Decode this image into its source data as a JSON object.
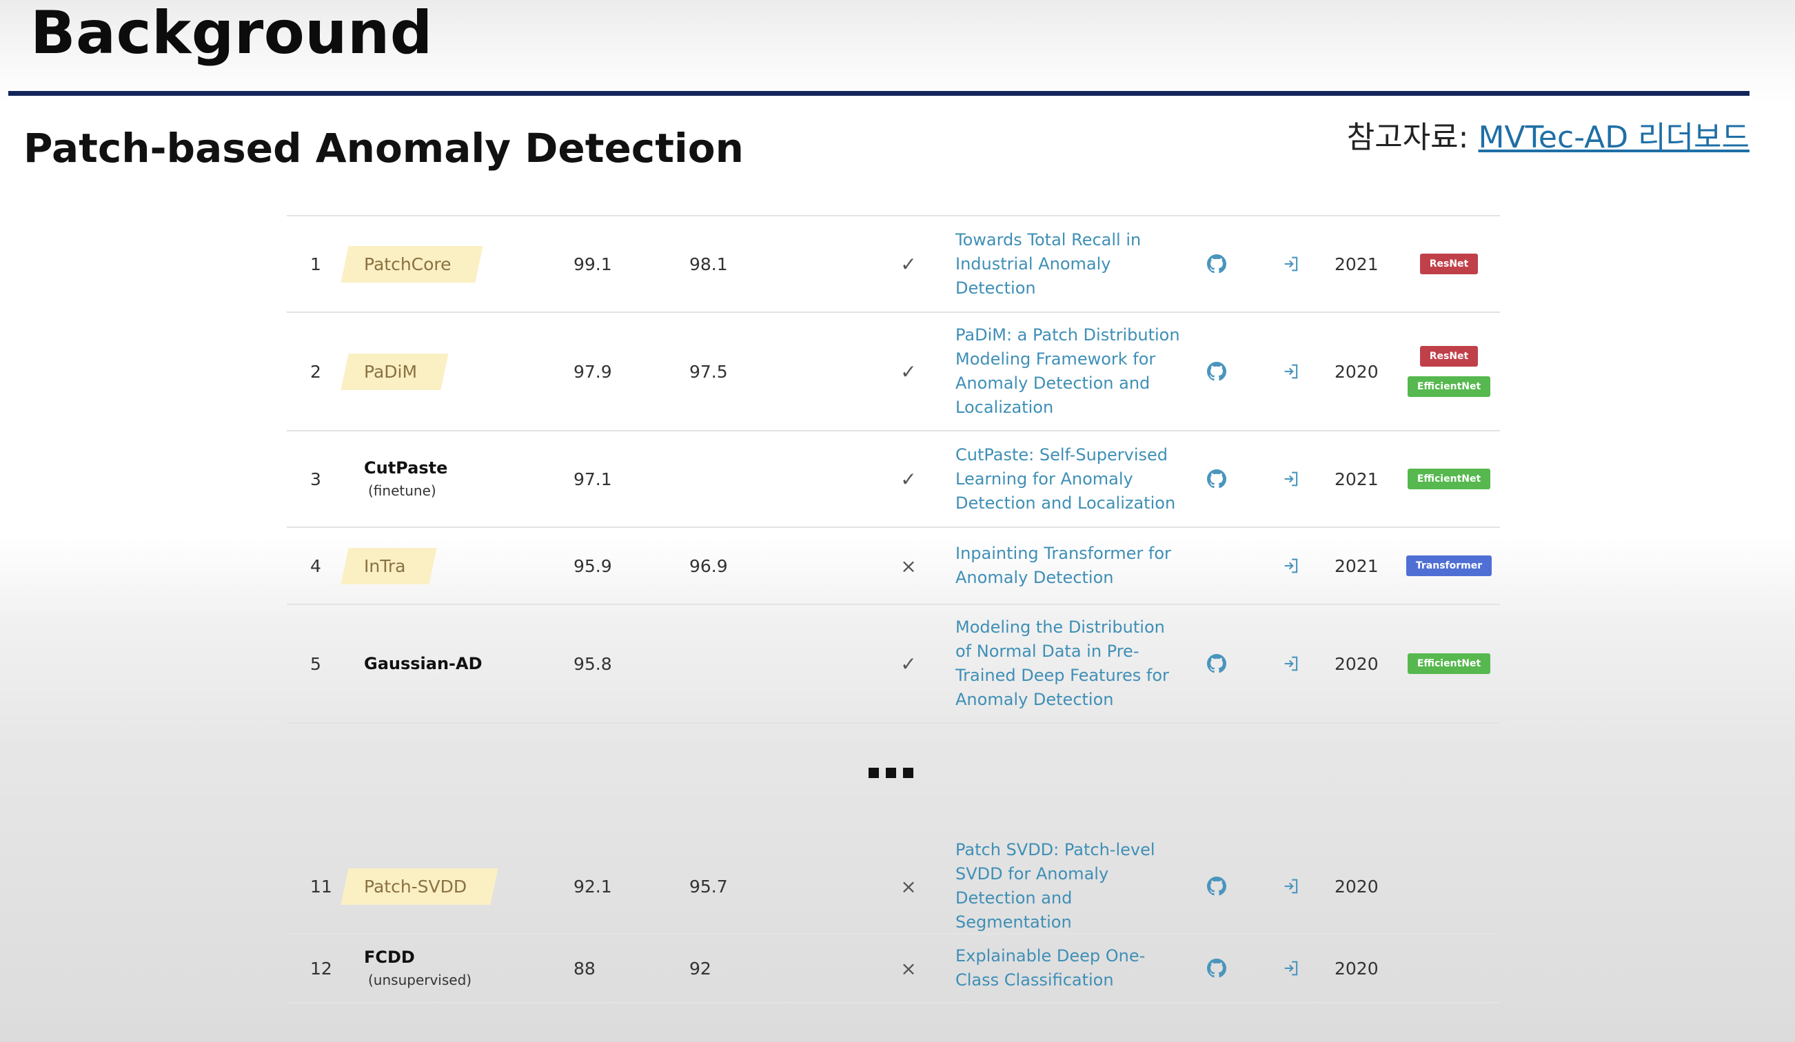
{
  "slide": {
    "title": "Background",
    "subtitle": "Patch-based Anomaly Detection",
    "ref_prefix": "참고자료: ",
    "ref_link": "MVTec-AD 리더보드"
  },
  "icons": {
    "code": "github-icon",
    "paper_link": "paper-link-icon",
    "extra_training_yes": "checkmark-icon",
    "extra_training_no": "x-icon",
    "ellipsis": "ellipsis-icon"
  },
  "colors": {
    "rule": "#13265c",
    "paper_link": "#3f8fb6",
    "highlight": "#fbefc4",
    "tag_resnet": "#c0404a",
    "tag_efficientnet": "#56b84e",
    "tag_transformer": "#4f6fd4"
  },
  "leaderboard": {
    "rows_top": [
      {
        "rank": "1",
        "model": "PatchCore",
        "model_sub": "",
        "highlight": true,
        "metric1": "99.1",
        "metric2": "98.1",
        "extra": "✓",
        "paper": "Towards Total Recall in Industrial Anomaly Detection",
        "code": true,
        "year": "2021",
        "tags": [
          "ResNet"
        ]
      },
      {
        "rank": "2",
        "model": "PaDiM",
        "model_sub": "",
        "highlight": true,
        "metric1": "97.9",
        "metric2": "97.5",
        "extra": "✓",
        "paper": "PaDiM: a Patch Distribution Modeling Framework for Anomaly Detection and Localization",
        "code": true,
        "year": "2020",
        "tags": [
          "ResNet",
          "EfficientNet"
        ]
      },
      {
        "rank": "3",
        "model": "CutPaste",
        "model_sub": "(finetune)",
        "highlight": false,
        "metric1": "97.1",
        "metric2": "",
        "extra": "✓",
        "paper": "CutPaste: Self-Supervised Learning for Anomaly Detection and Localization",
        "code": true,
        "year": "2021",
        "tags": [
          "EfficientNet"
        ]
      },
      {
        "rank": "4",
        "model": "InTra",
        "model_sub": "",
        "highlight": true,
        "metric1": "95.9",
        "metric2": "96.9",
        "extra": "×",
        "paper": "Inpainting Transformer for Anomaly Detection",
        "code": false,
        "year": "2021",
        "tags": [
          "Transformer"
        ]
      },
      {
        "rank": "5",
        "model": "Gaussian-AD",
        "model_sub": "",
        "highlight": false,
        "metric1": "95.8",
        "metric2": "",
        "extra": "✓",
        "paper": "Modeling the Distribution of Normal Data in Pre-Trained Deep Features for Anomaly Detection",
        "code": true,
        "year": "2020",
        "tags": [
          "EfficientNet"
        ]
      }
    ],
    "rows_bottom": [
      {
        "rank": "11",
        "model": "Patch-SVDD",
        "model_sub": "",
        "highlight": true,
        "metric1": "92.1",
        "metric2": "95.7",
        "extra": "×",
        "paper": "Patch SVDD: Patch-level SVDD for Anomaly Detection and Segmentation",
        "code": true,
        "year": "2020",
        "tags": []
      },
      {
        "rank": "12",
        "model": "FCDD",
        "model_sub": "(unsupervised)",
        "highlight": false,
        "metric1": "88",
        "metric2": "92",
        "extra": "×",
        "paper": "Explainable Deep One-Class Classification",
        "code": true,
        "year": "2020",
        "tags": []
      }
    ]
  }
}
